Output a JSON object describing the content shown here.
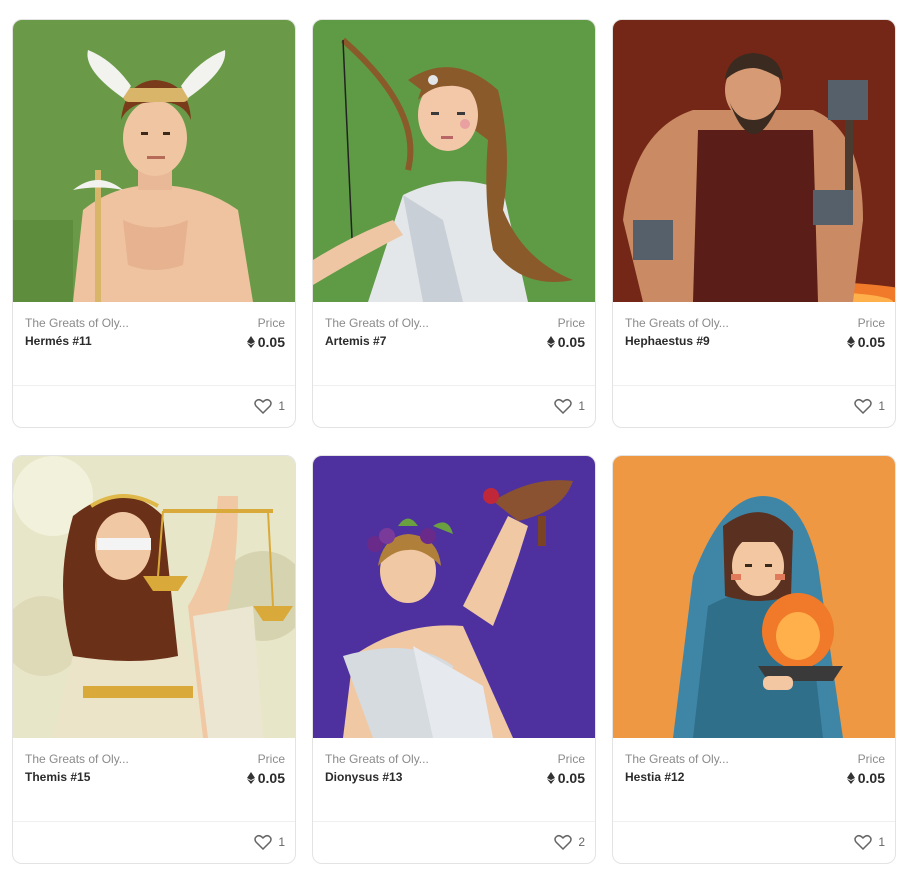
{
  "cards": [
    {
      "collection": "The Greats of Oly...",
      "price_label": "Price",
      "name": "Hermés #11",
      "price": "0.05",
      "likes": "1",
      "bg": "#6a9a47",
      "icon": "hermes-artwork"
    },
    {
      "collection": "The Greats of Oly...",
      "price_label": "Price",
      "name": "Artemis #7",
      "price": "0.05",
      "likes": "1",
      "bg": "#5f9a45",
      "icon": "artemis-artwork"
    },
    {
      "collection": "The Greats of Oly...",
      "price_label": "Price",
      "name": "Hephaestus #9",
      "price": "0.05",
      "likes": "1",
      "bg": "#7a2a18",
      "icon": "hephaestus-artwork"
    },
    {
      "collection": "The Greats of Oly...",
      "price_label": "Price",
      "name": "Themis #15",
      "price": "0.05",
      "likes": "1",
      "bg": "#e8e6c8",
      "icon": "themis-artwork"
    },
    {
      "collection": "The Greats of Oly...",
      "price_label": "Price",
      "name": "Dionysus #13",
      "price": "0.05",
      "likes": "2",
      "bg": "#4a2f9a",
      "icon": "dionysus-artwork"
    },
    {
      "collection": "The Greats of Oly...",
      "price_label": "Price",
      "name": "Hestia #12",
      "price": "0.05",
      "likes": "1",
      "bg": "#ee9540",
      "icon": "hestia-artwork"
    }
  ]
}
